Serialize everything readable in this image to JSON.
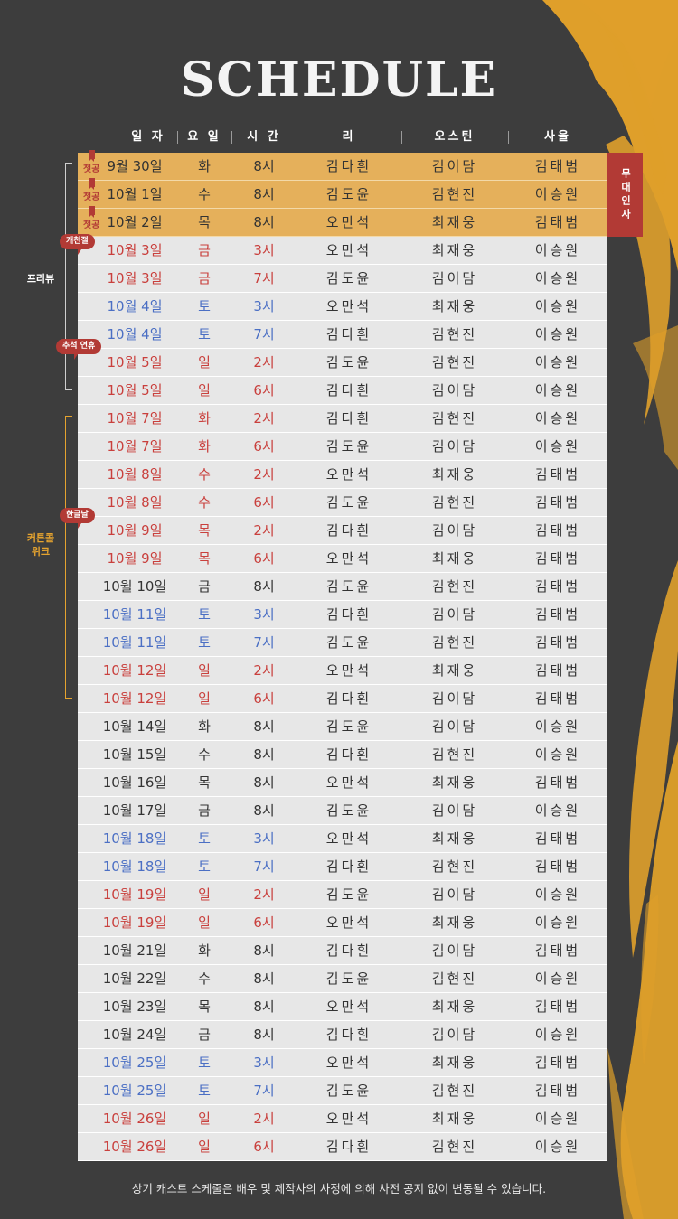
{
  "title": "SCHEDULE",
  "columns": [
    "일 자",
    "요 일",
    "시 간",
    "리",
    "오스틴",
    "사울"
  ],
  "first_tag": "첫공",
  "greeting_label": "무대인사",
  "groups": {
    "preview": "프리뷰",
    "curtain": "커튼콜 위크",
    "curtain_line1": "커튼콜",
    "curtain_line2": "위크"
  },
  "badges": {
    "opening": "개천절",
    "chuseok": "추석 연휴",
    "hangul": "한글날"
  },
  "colors": {
    "background": "#3d3d3d",
    "gold": "#e5b05b",
    "accent_red": "#b23a35",
    "sunday_holiday": "#c9403d",
    "saturday": "#4b6fc4"
  },
  "rows": [
    {
      "date": "9월 30일",
      "day": "화",
      "time": "8시",
      "lee": "김다흰",
      "austin": "김이담",
      "saul": "김태범",
      "tone": "dark",
      "first": true
    },
    {
      "date": "10월 1일",
      "day": "수",
      "time": "8시",
      "lee": "김도윤",
      "austin": "김현진",
      "saul": "이승원",
      "tone": "dark",
      "first": true
    },
    {
      "date": "10월 2일",
      "day": "목",
      "time": "8시",
      "lee": "오만석",
      "austin": "최재웅",
      "saul": "김태범",
      "tone": "dark",
      "first": true
    },
    {
      "date": "10월 3일",
      "day": "금",
      "time": "3시",
      "lee": "오만석",
      "austin": "최재웅",
      "saul": "이승원",
      "tone": "red"
    },
    {
      "date": "10월 3일",
      "day": "금",
      "time": "7시",
      "lee": "김도윤",
      "austin": "김이담",
      "saul": "이승원",
      "tone": "red"
    },
    {
      "date": "10월 4일",
      "day": "토",
      "time": "3시",
      "lee": "오만석",
      "austin": "최재웅",
      "saul": "이승원",
      "tone": "blue"
    },
    {
      "date": "10월 4일",
      "day": "토",
      "time": "7시",
      "lee": "김다흰",
      "austin": "김현진",
      "saul": "이승원",
      "tone": "blue"
    },
    {
      "date": "10월 5일",
      "day": "일",
      "time": "2시",
      "lee": "김도윤",
      "austin": "김현진",
      "saul": "이승원",
      "tone": "red"
    },
    {
      "date": "10월 5일",
      "day": "일",
      "time": "6시",
      "lee": "김다흰",
      "austin": "김이담",
      "saul": "이승원",
      "tone": "red"
    },
    {
      "date": "10월 7일",
      "day": "화",
      "time": "2시",
      "lee": "김다흰",
      "austin": "김현진",
      "saul": "이승원",
      "tone": "red"
    },
    {
      "date": "10월 7일",
      "day": "화",
      "time": "6시",
      "lee": "김도윤",
      "austin": "김이담",
      "saul": "이승원",
      "tone": "red"
    },
    {
      "date": "10월 8일",
      "day": "수",
      "time": "2시",
      "lee": "오만석",
      "austin": "최재웅",
      "saul": "김태범",
      "tone": "red"
    },
    {
      "date": "10월 8일",
      "day": "수",
      "time": "6시",
      "lee": "김도윤",
      "austin": "김현진",
      "saul": "김태범",
      "tone": "red"
    },
    {
      "date": "10월 9일",
      "day": "목",
      "time": "2시",
      "lee": "김다흰",
      "austin": "김이담",
      "saul": "김태범",
      "tone": "red"
    },
    {
      "date": "10월 9일",
      "day": "목",
      "time": "6시",
      "lee": "오만석",
      "austin": "최재웅",
      "saul": "김태범",
      "tone": "red"
    },
    {
      "date": "10월 10일",
      "day": "금",
      "time": "8시",
      "lee": "김도윤",
      "austin": "김현진",
      "saul": "김태범",
      "tone": "dark"
    },
    {
      "date": "10월 11일",
      "day": "토",
      "time": "3시",
      "lee": "김다흰",
      "austin": "김이담",
      "saul": "김태범",
      "tone": "blue"
    },
    {
      "date": "10월 11일",
      "day": "토",
      "time": "7시",
      "lee": "김도윤",
      "austin": "김현진",
      "saul": "김태범",
      "tone": "blue"
    },
    {
      "date": "10월 12일",
      "day": "일",
      "time": "2시",
      "lee": "오만석",
      "austin": "최재웅",
      "saul": "김태범",
      "tone": "red"
    },
    {
      "date": "10월 12일",
      "day": "일",
      "time": "6시",
      "lee": "김다흰",
      "austin": "김이담",
      "saul": "김태범",
      "tone": "red"
    },
    {
      "date": "10월 14일",
      "day": "화",
      "time": "8시",
      "lee": "김도윤",
      "austin": "김이담",
      "saul": "이승원",
      "tone": "dark"
    },
    {
      "date": "10월 15일",
      "day": "수",
      "time": "8시",
      "lee": "김다흰",
      "austin": "김현진",
      "saul": "이승원",
      "tone": "dark"
    },
    {
      "date": "10월 16일",
      "day": "목",
      "time": "8시",
      "lee": "오만석",
      "austin": "최재웅",
      "saul": "김태범",
      "tone": "dark"
    },
    {
      "date": "10월 17일",
      "day": "금",
      "time": "8시",
      "lee": "김도윤",
      "austin": "김이담",
      "saul": "이승원",
      "tone": "dark"
    },
    {
      "date": "10월 18일",
      "day": "토",
      "time": "3시",
      "lee": "오만석",
      "austin": "최재웅",
      "saul": "김태범",
      "tone": "blue"
    },
    {
      "date": "10월 18일",
      "day": "토",
      "time": "7시",
      "lee": "김다흰",
      "austin": "김현진",
      "saul": "김태범",
      "tone": "blue"
    },
    {
      "date": "10월 19일",
      "day": "일",
      "time": "2시",
      "lee": "김도윤",
      "austin": "김이담",
      "saul": "이승원",
      "tone": "red"
    },
    {
      "date": "10월 19일",
      "day": "일",
      "time": "6시",
      "lee": "오만석",
      "austin": "최재웅",
      "saul": "이승원",
      "tone": "red"
    },
    {
      "date": "10월 21일",
      "day": "화",
      "time": "8시",
      "lee": "김다흰",
      "austin": "김이담",
      "saul": "김태범",
      "tone": "dark"
    },
    {
      "date": "10월 22일",
      "day": "수",
      "time": "8시",
      "lee": "김도윤",
      "austin": "김현진",
      "saul": "이승원",
      "tone": "dark"
    },
    {
      "date": "10월 23일",
      "day": "목",
      "time": "8시",
      "lee": "오만석",
      "austin": "최재웅",
      "saul": "김태범",
      "tone": "dark"
    },
    {
      "date": "10월 24일",
      "day": "금",
      "time": "8시",
      "lee": "김다흰",
      "austin": "김이담",
      "saul": "이승원",
      "tone": "dark"
    },
    {
      "date": "10월 25일",
      "day": "토",
      "time": "3시",
      "lee": "오만석",
      "austin": "최재웅",
      "saul": "김태범",
      "tone": "blue"
    },
    {
      "date": "10월 25일",
      "day": "토",
      "time": "7시",
      "lee": "김도윤",
      "austin": "김현진",
      "saul": "김태범",
      "tone": "blue"
    },
    {
      "date": "10월 26일",
      "day": "일",
      "time": "2시",
      "lee": "오만석",
      "austin": "최재웅",
      "saul": "이승원",
      "tone": "red"
    },
    {
      "date": "10월 26일",
      "day": "일",
      "time": "6시",
      "lee": "김다흰",
      "austin": "김현진",
      "saul": "이승원",
      "tone": "red"
    }
  ],
  "footer": "상기 캐스트 스케줄은 배우 및 제작사의 사정에 의해 사전 공지 없이 변동될 수 있습니다."
}
